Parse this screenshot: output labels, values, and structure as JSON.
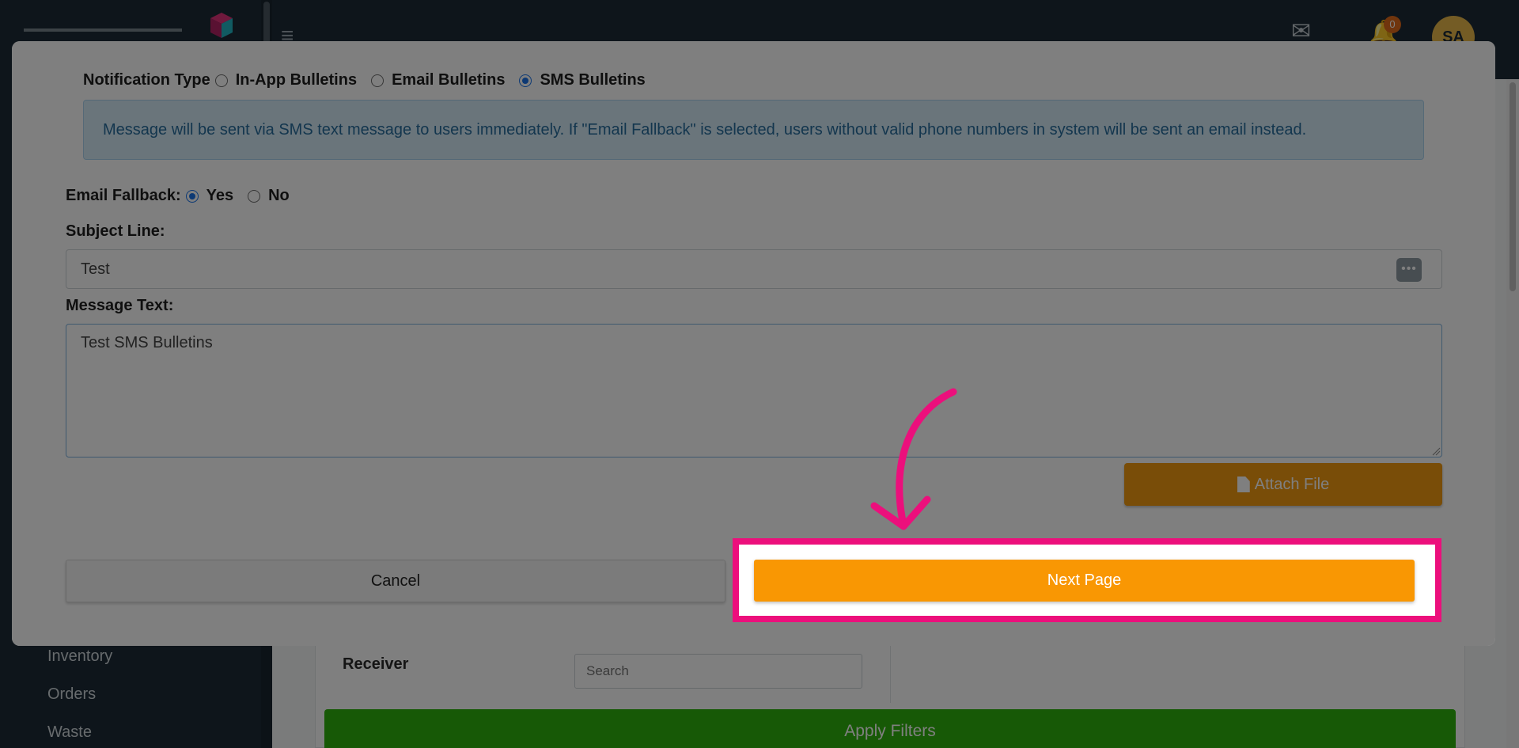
{
  "background": {
    "badge_count": "0",
    "avatar_initials": "SA",
    "sidebar": [
      "Inventory",
      "Orders",
      "Waste"
    ],
    "filters": {
      "receiver_label": "Receiver",
      "receiver_placeholder": "Search",
      "apply_label": "Apply Filters"
    }
  },
  "modal": {
    "notification_type_label": "Notification Type",
    "notification_options": [
      "In-App Bulletins",
      "Email Bulletins",
      "SMS Bulletins"
    ],
    "selected_notification": "SMS Bulletins",
    "info_message": "Message will be sent via SMS text message to users immediately. If \"Email Fallback\" is selected, users without valid phone numbers in system will be sent an email instead.",
    "email_fallback_label": "Email Fallback:",
    "fallback_options": [
      "Yes",
      "No"
    ],
    "selected_fallback": "Yes",
    "subject_label": "Subject Line:",
    "subject_value": "Test",
    "message_label": "Message Text:",
    "message_value": "Test SMS Bulletins",
    "attach_label": "Attach File",
    "cancel_label": "Cancel",
    "next_label": "Next Page"
  },
  "colors": {
    "accent_orange": "#f99703",
    "highlight_pink": "#ec0f7c",
    "info_bg": "#d5eaf7",
    "apply_green": "#2fb30c"
  }
}
